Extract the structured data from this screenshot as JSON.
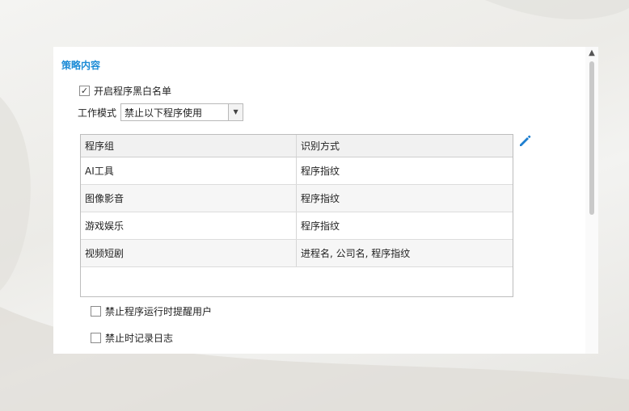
{
  "section": {
    "title": "策略内容"
  },
  "enable_list": {
    "label": "开启程序黑白名单",
    "checked": true
  },
  "work_mode": {
    "label": "工作模式",
    "selected": "禁止以下程序使用"
  },
  "table": {
    "headers": [
      "程序组",
      "识别方式"
    ],
    "rows": [
      [
        "AI工具",
        "程序指纹"
      ],
      [
        "图像影音",
        "程序指纹"
      ],
      [
        "游戏娱乐",
        "程序指纹"
      ],
      [
        "视频短剧",
        "进程名, 公司名, 程序指纹"
      ]
    ]
  },
  "notify_user": {
    "label": "禁止程序运行时提醒用户",
    "checked": false
  },
  "log_record": {
    "label": "禁止时记录日志",
    "checked": false
  },
  "colors": {
    "accent": "#1b8bd6",
    "edit_icon": "#1e7fd0"
  },
  "icons": {
    "edit": "pencil-icon",
    "scroll_up": "chevron-up-icon",
    "dropdown": "caret-down-icon"
  }
}
